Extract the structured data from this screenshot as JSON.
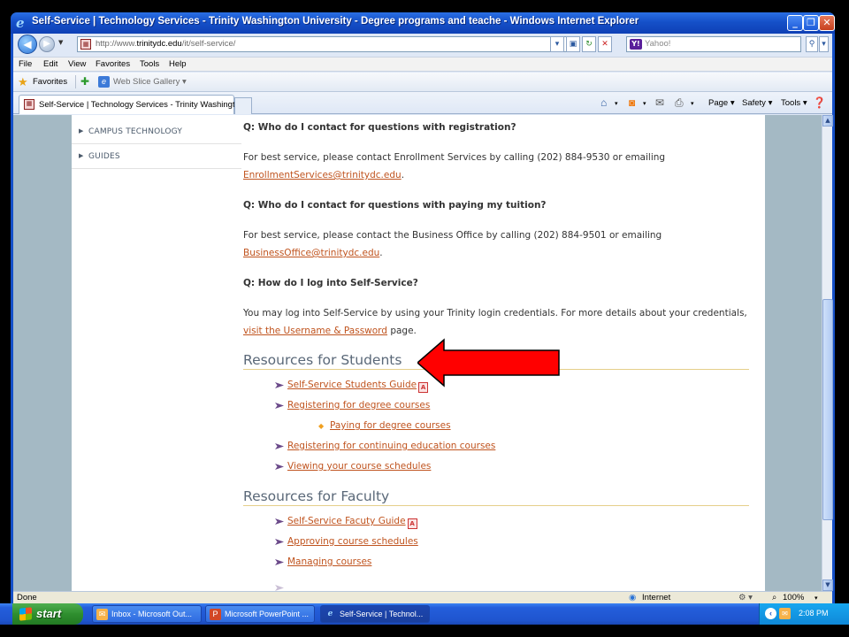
{
  "window": {
    "title": "Self-Service | Technology Services - Trinity Washington University - Degree programs and teache - Windows Internet Explorer"
  },
  "address": {
    "url_prefix": "http://www.",
    "url_domain": "trinitydc.edu",
    "url_path": "/it/self-service/"
  },
  "search": {
    "placeholder": "Yahoo!"
  },
  "menu": [
    "File",
    "Edit",
    "View",
    "Favorites",
    "Tools",
    "Help"
  ],
  "favorites": {
    "label": "Favorites",
    "gallery": "Web Slice Gallery ▾"
  },
  "tab": {
    "label": "Self-Service | Technology Services - Trinity Washingto..."
  },
  "commandbar": {
    "page": "Page ▾",
    "safety": "Safety ▾",
    "tools": "Tools ▾"
  },
  "sidebar": {
    "items": [
      {
        "label": "CAMPUS TECHNOLOGY"
      },
      {
        "label": "GUIDES"
      }
    ]
  },
  "content": {
    "q1": "Q: Who do I contact for questions with registration?",
    "a1_text": "For best service, please contact Enrollment Services by calling (202) 884-9530 or emailing",
    "a1_link": "EnrollmentServices@trinitydc.edu",
    "a1_end": ".",
    "q2": "Q: Who do I contact for questions with paying my tuition?",
    "a2_text": "For best service, please contact the Business Office by calling (202) 884-9501 or emailing",
    "a2_link": "BusinessOffice@trinitydc.edu",
    "a2_end": ".",
    "q3": "Q: How do I log into Self-Service?",
    "a3_text": "You may log into Self-Service by using your Trinity login credentials. For more details about your credentials,",
    "a3_link": "visit the Username & Password",
    "a3_end": " page.",
    "students_heading": "Resources for Students",
    "students_links": [
      "Self-Service Students Guide",
      "Registering for degree courses",
      "Paying for degree courses",
      "Registering for continuing education courses",
      "Viewing your course schedules"
    ],
    "faculty_heading": "Resources for Faculty",
    "faculty_links": [
      "Self-Service Facuty Guide",
      "Approving course schedules",
      "Managing courses"
    ]
  },
  "status": {
    "left": "Done",
    "zone": "Internet",
    "zoom": "100%"
  },
  "taskbar": {
    "start": "start",
    "tasks": [
      {
        "label": "Inbox - Microsoft Out..."
      },
      {
        "label": "Microsoft PowerPoint ..."
      },
      {
        "label": "Self-Service | Technol..."
      }
    ],
    "clock": "2:08 PM"
  },
  "colors": {
    "link": "#c0541f",
    "arrow": "#ff0000",
    "titlebar": "#1550c8"
  }
}
